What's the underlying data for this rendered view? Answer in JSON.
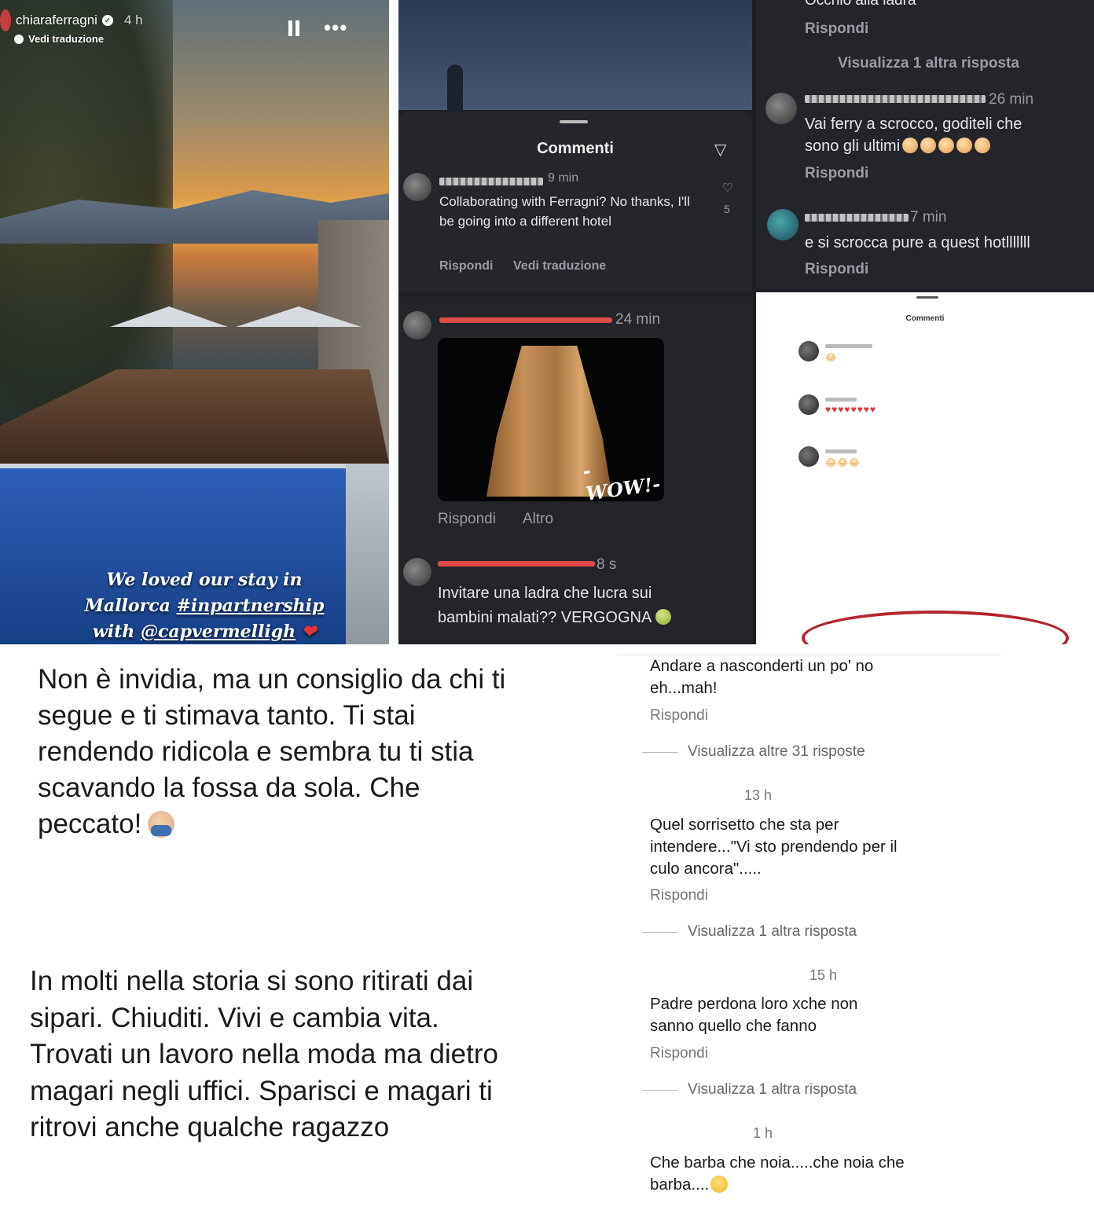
{
  "story": {
    "username": "chiaraferragni",
    "time": "4 h",
    "translate": "Vedi traduzione",
    "caption_line1": "We loved our stay in",
    "caption_line2a": "Mallorca ",
    "caption_line2b": "#inpartnership",
    "caption_line3a": "with ",
    "caption_line3b": "@capvermelligh",
    "heart": "❤"
  },
  "panel_mid_top": {
    "title": "Commenti",
    "time": "9 min",
    "comment": "Collaborating with Ferragni? No thanks, I'll be going into a different hotel",
    "reply": "Rispondi",
    "translate": "Vedi traduzione",
    "likes": "5"
  },
  "panel_right_top": {
    "top_text": "Occhio alla ladra",
    "reply": "Rispondi",
    "view_more": "Visualizza 1 altra risposta",
    "c1_time": "26 min",
    "c1_line1": "Vai ferry a scrocco, goditeli che",
    "c1_line2": "sono gli ultimi",
    "c2_time": "7 min",
    "c2_text": "e si scrocca  pure a quest hotlllllll"
  },
  "panel_mid_bot": {
    "c1_time": "24 min",
    "image_caption": "-WOW!-",
    "reply": "Rispondi",
    "other": "Altro",
    "c2_time": "8 s",
    "c2_line1": "Invitare una ladra che lucra sui",
    "c2_line2": "bambini malati?? VERGOGNA"
  },
  "panel_right_bot": {
    "title": "Commenti",
    "row1_emoji": "😂",
    "row2_emoji": "♥♥♥♥♥♥♥♥",
    "row3_emoji": "😂😂😂"
  },
  "text_block_1": "Non è invidia, ma un consiglio da chi ti segue e ti stimava tanto. Ti stai rendendo ridicola e sembra tu ti stia scavando la fossa da sola. Che peccato!",
  "text_block_2": "In molti nella storia si sono ritirati dai sipari. Chiuditi. Vivi e cambia vita. Trovati un lavoro nella moda ma dietro magari negli uffici. Sparisci e magari ti ritrovi anche qualche ragazzo",
  "fb_comments": {
    "c1_line1": "Andare a nasconderti un po' no",
    "c1_line2": "eh...mah!",
    "c1_reply": "Rispondi",
    "c1_more": "Visualizza altre 31 risposte",
    "c2_time": "13 h",
    "c2_line1": "Quel sorrisetto che sta per",
    "c2_line2": "intendere...\"Vi sto prendendo per il",
    "c2_line3": "culo ancora\".....",
    "c2_reply": "Rispondi",
    "c2_more": "Visualizza 1 altra risposta",
    "c3_time": "15 h",
    "c3_line1": "Padre perdona loro xche non",
    "c3_line2": "sanno quello che fanno",
    "c3_reply": "Rispondi",
    "c3_more": "Visualizza 1 altra risposta",
    "c4_time": "1 h",
    "c4_line1": "Che barba che noia.....che noia che",
    "c4_line2": "barba...."
  }
}
